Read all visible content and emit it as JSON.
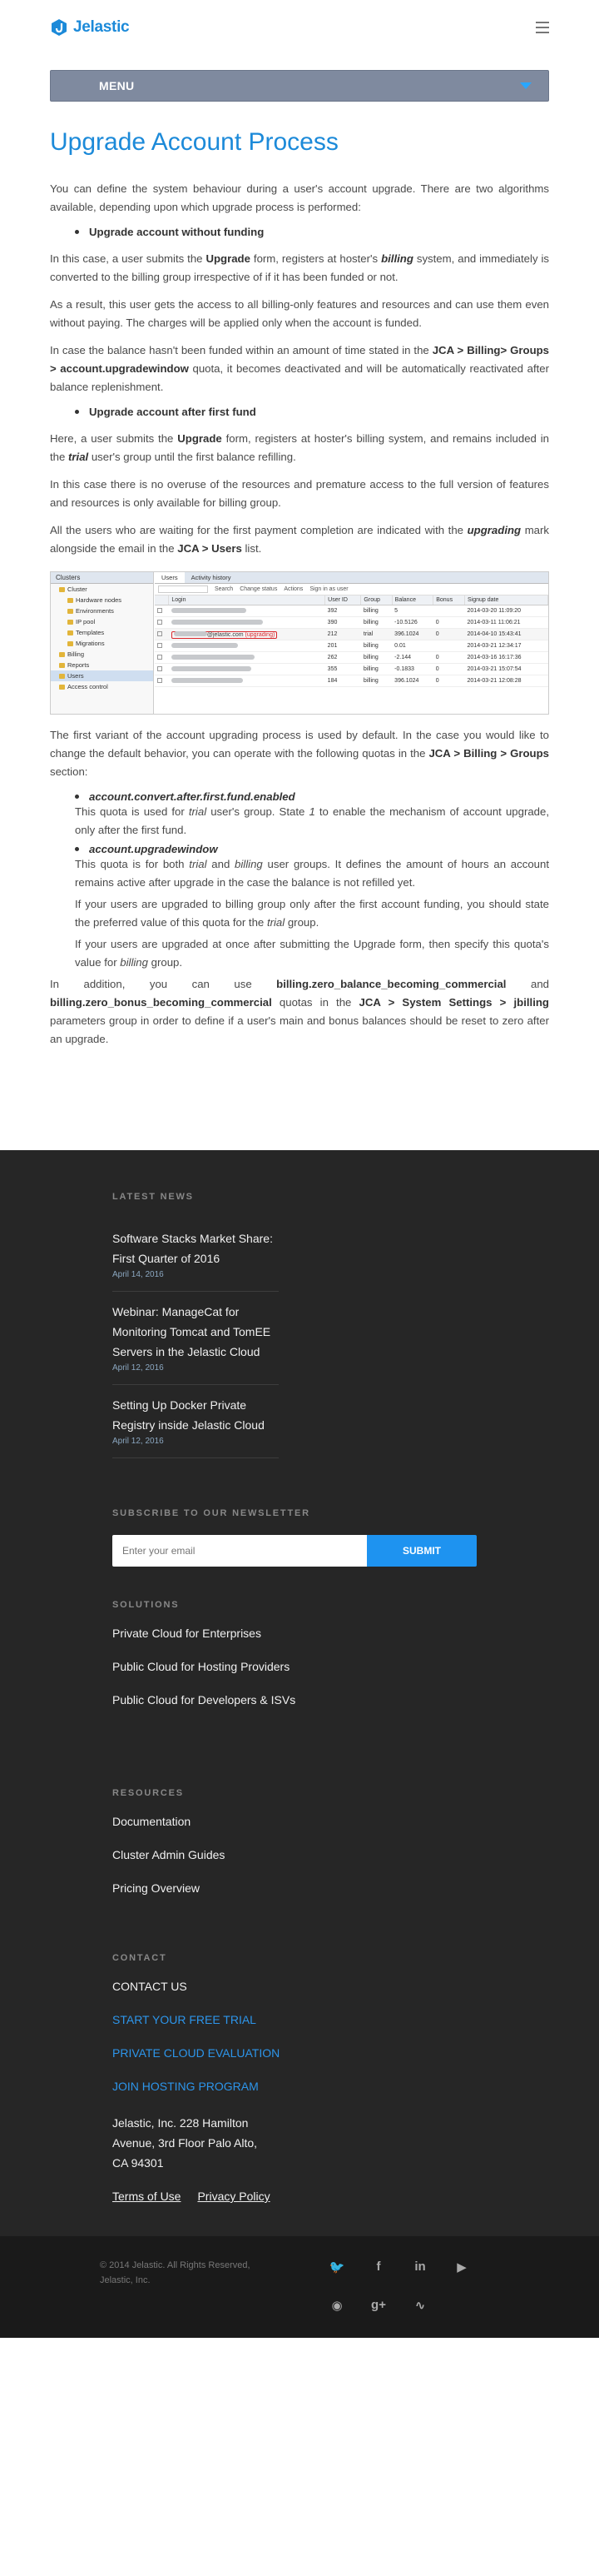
{
  "header": {
    "logo_text": "Jelastic",
    "menu_label": "MENU"
  },
  "article": {
    "title": "Upgrade Account Process",
    "intro": "You can define the system behaviour during a user's account upgrade. There are two algorithms available, depending upon which upgrade process is performed:",
    "bullet1": "Upgrade account without funding",
    "p1_a": "In this case, a user submits the ",
    "p1_b": "Upgrade",
    "p1_c": " form, registers at hoster's ",
    "p1_d": "billing",
    "p1_e": " system, and immediately is converted to the billing group irrespective of if it has been funded or not.",
    "p2": "As a result, this user gets the access to all billing-only features and resources and can use them even without paying. The charges will be applied only when the account is funded.",
    "p3_a": "In case the balance hasn't been funded within an amount of time stated in the ",
    "p3_b": "JCA > Billing> Groups > account.upgradewindow",
    "p3_c": " quota, it becomes deactivated and will be automatically reactivated after balance replenishment.",
    "bullet2": "Upgrade account after first fund",
    "p4_a": "Here, a user submits the ",
    "p4_b": "Upgrade",
    "p4_c": " form, registers at hoster's billing system, and remains included in the ",
    "p4_d": "trial",
    "p4_e": " user's group until the first balance refilling.",
    "p5": "In this case there is no overuse of the resources and premature access to the full version of features and resources is only available for billing group.",
    "p6_a": "All the users who are waiting for the first payment completion are indicated with the ",
    "p6_b": "upgrading",
    "p6_c": " mark alongside the email in the ",
    "p6_d": "JCA > Users",
    "p6_e": " list.",
    "p7_a": "The first variant of the account upgrading process is used by default. In the case you would like to change the default behavior, you can operate with the following quotas in the ",
    "p7_b": "JCA > Billing > Groups",
    "p7_c": " section:",
    "q1_name": "account.convert.after.first.fund.enabled",
    "q1_a": "This quota is used for ",
    "q1_b": "trial",
    "q1_c": " user's group. State ",
    "q1_d": "1",
    "q1_e": " to enable the mechanism of account upgrade, only after the first fund.",
    "q2_name": "account.upgradewindow",
    "q2_a": "This quota is for both ",
    "q2_b": "trial",
    "q2_c": " and ",
    "q2_d": "billing",
    "q2_e": " user groups. It defines the amount of hours an account remains active after upgrade in the case the balance is not refilled yet.",
    "q2_f": "If your users are upgraded to billing group only after the first account funding, you should state the preferred value of this quota for the ",
    "q2_g": "trial",
    "q2_h": " group.",
    "q2_i": "If your users are upgraded at once after submitting the Upgrade form, then specify this quota's value for ",
    "q2_j": "billing",
    "q2_k": " group.",
    "p8_a": "In addition, you can use ",
    "p8_b": "billing.zero_balance_becoming_commercial",
    "p8_c": " and ",
    "p8_d": "billing.zero_bonus_becoming_commercial",
    "p8_e": " quotas in the ",
    "p8_f": "JCA > System Settings > jbilling",
    "p8_g": " parameters group in order to define if a user's main and bonus balances should be reset to zero after an upgrade."
  },
  "screenshot": {
    "left_header": "Clusters",
    "tree": [
      "Cluster",
      "Hardware nodes",
      "Environments",
      "IP pool",
      "Templates",
      "Migrations",
      "Billing",
      "Reports",
      "Users",
      "Access control"
    ],
    "tabs": [
      "Users",
      "Activity history"
    ],
    "toolbar": [
      "Search",
      "Change status",
      "Actions",
      "Sign in as user"
    ],
    "columns": [
      "Login",
      "User ID",
      "Group",
      "Balance",
      "Bonus",
      "Signup date"
    ],
    "rows": [
      {
        "id": "392",
        "group": "billing",
        "balance": "5",
        "bonus": "",
        "date": "2014-03-20 11:09:20",
        "cls": "neg"
      },
      {
        "id": "390",
        "group": "billing",
        "balance": "-10.5126",
        "bonus": "0",
        "date": "2014-03-11 11:06:21",
        "cls": "neg"
      },
      {
        "id": "212",
        "group": "trial",
        "balance": "396.1024",
        "bonus": "0",
        "date": "2014-04-10 15:43:41",
        "cls": "pos"
      },
      {
        "id": "201",
        "group": "billing",
        "balance": "0.01",
        "bonus": "",
        "date": "2014-03-21 12:34:17",
        "cls": "pos"
      },
      {
        "id": "262",
        "group": "billing",
        "balance": "-2.144",
        "bonus": "0",
        "date": "2014-03-16 16:17:36",
        "cls": "neg"
      },
      {
        "id": "355",
        "group": "billing",
        "balance": "-0.1833",
        "bonus": "0",
        "date": "2014-03-21 15:07:54",
        "cls": "neg"
      },
      {
        "id": "184",
        "group": "billing",
        "balance": "396.1024",
        "bonus": "0",
        "date": "2014-03-21 12:08:28",
        "cls": "pos"
      }
    ],
    "domain_label": "@jelastic.com",
    "mark_label": "(upgrading)"
  },
  "footer": {
    "news_heading": "LATEST NEWS",
    "news": [
      {
        "title": "Software Stacks Market Share: First Quarter of 2016",
        "date": "April 14, 2016"
      },
      {
        "title": "Webinar: ManageCat for Monitoring Tomcat and TomEE Servers in the Jelastic Cloud",
        "date": "April 12, 2016"
      },
      {
        "title": "Setting Up Docker Private Registry inside Jelastic Cloud",
        "date": "April 12, 2016"
      }
    ],
    "subscribe_heading": "SUBSCRIBE TO OUR NEWSLETTER",
    "email_placeholder": "Enter your email",
    "submit_label": "SUBMIT",
    "solutions_heading": "SOLUTIONS",
    "solutions": [
      "Private Cloud for Enterprises",
      "Public Cloud for Hosting Providers",
      "Public Cloud for Developers & ISVs"
    ],
    "resources_heading": "RESOURCES",
    "resources": [
      "Documentation",
      "Cluster Admin Guides",
      "Pricing Overview"
    ],
    "contact_heading": "CONTACT",
    "contact_us": "CONTACT US",
    "contact_links": [
      "START YOUR FREE TRIAL",
      "PRIVATE CLOUD EVALUATION",
      "JOIN HOSTING PROGRAM"
    ],
    "address": "Jelastic, Inc. 228 Hamilton Avenue, 3rd Floor Palo Alto, CA 94301",
    "terms": "Terms of Use",
    "privacy": "Privacy Policy",
    "copyright": "© 2014 Jelastic. All Rights Reserved, Jelastic, Inc."
  },
  "colors": {
    "brand_blue": "#1c8ad9",
    "menu_bar": "#7f8a9f",
    "footer_bg": "#262626",
    "submit_blue": "#1e93f0"
  }
}
